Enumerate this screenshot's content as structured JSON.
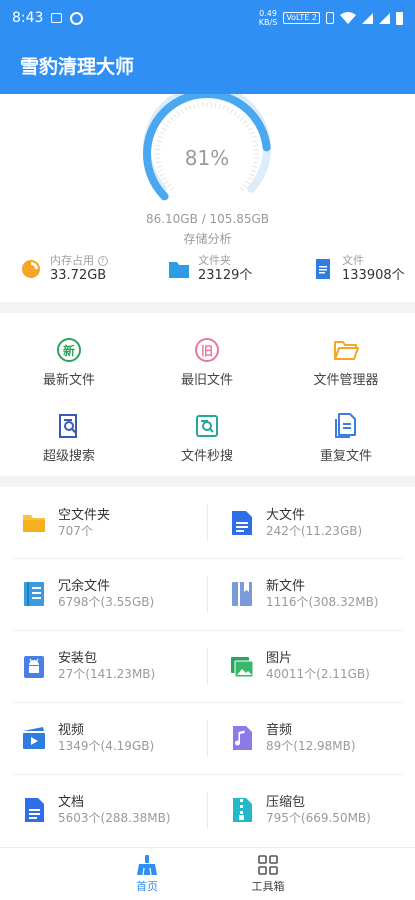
{
  "status_bar": {
    "time": "8:43",
    "net_speed_top": "0.49",
    "net_speed_bottom": "KB/S",
    "volte": "VoLTE 2",
    "icons": [
      "image-icon",
      "vpn-icon",
      "vibrate-icon",
      "wifi-icon",
      "signal-icon",
      "signal-icon",
      "battery-icon"
    ]
  },
  "app": {
    "title": "雪豹清理大师",
    "accent": "#2f8ff3"
  },
  "storage": {
    "percent_label": "81%",
    "percent": 81,
    "capacity": "86.10GB / 105.85GB",
    "caption": "存储分析",
    "stats": [
      {
        "label": "内存占用",
        "help": "?",
        "value": "33.72GB",
        "icon": "pie-chart-icon"
      },
      {
        "label": "文件夹",
        "value": "23129个",
        "icon": "folder-icon"
      },
      {
        "label": "文件",
        "value": "133908个",
        "icon": "document-icon"
      }
    ]
  },
  "tools": [
    {
      "label": "最新文件",
      "glyph": "新",
      "icon": "newest-files-icon",
      "color": "#2aa55c"
    },
    {
      "label": "最旧文件",
      "glyph": "旧",
      "icon": "oldest-files-icon",
      "color": "#e8779a"
    },
    {
      "label": "文件管理器",
      "icon": "open-folder-icon",
      "color": "#f5a623"
    },
    {
      "label": "超级搜索",
      "icon": "doc-search-icon",
      "color": "#3a5bb5"
    },
    {
      "label": "文件秒搜",
      "icon": "quick-search-icon",
      "color": "#25a69a"
    },
    {
      "label": "重复文件",
      "icon": "duplicate-files-icon",
      "color": "#3a7fe0"
    }
  ],
  "categories": [
    {
      "name": "空文件夹",
      "stat": "707个",
      "icon": "empty-folder-icon",
      "color": "#f7c33a"
    },
    {
      "name": "大文件",
      "stat": "242个(11.23GB)",
      "icon": "large-file-icon",
      "color": "#2f6ee8"
    },
    {
      "name": "冗余文件",
      "stat": "6798个(3.55GB)",
      "icon": "redundant-files-icon",
      "color": "#3a9be0"
    },
    {
      "name": "新文件",
      "stat": "1116个(308.32MB)",
      "icon": "new-files-icon",
      "color": "#7a9ad8"
    },
    {
      "name": "安装包",
      "stat": "27个(141.23MB)",
      "icon": "android-package-icon",
      "color": "#4a7fe6"
    },
    {
      "name": "图片",
      "stat": "40011个(2.11GB)",
      "icon": "picture-icon",
      "color": "#2aa55c"
    },
    {
      "name": "视频",
      "stat": "1349个(4.19GB)",
      "icon": "video-icon",
      "color": "#2f7de0"
    },
    {
      "name": "音频",
      "stat": "89个(12.98MB)",
      "icon": "audio-icon",
      "color": "#8a7be8"
    },
    {
      "name": "文档",
      "stat": "5603个(288.38MB)",
      "icon": "document-icon",
      "color": "#2f6ee8"
    },
    {
      "name": "压缩包",
      "stat": "795个(669.50MB)",
      "icon": "zip-icon",
      "color": "#25b8c8"
    }
  ],
  "bottom_nav": [
    {
      "label": "首页",
      "icon": "broom-icon",
      "active": true
    },
    {
      "label": "工具箱",
      "icon": "grid-icon",
      "active": false
    }
  ]
}
